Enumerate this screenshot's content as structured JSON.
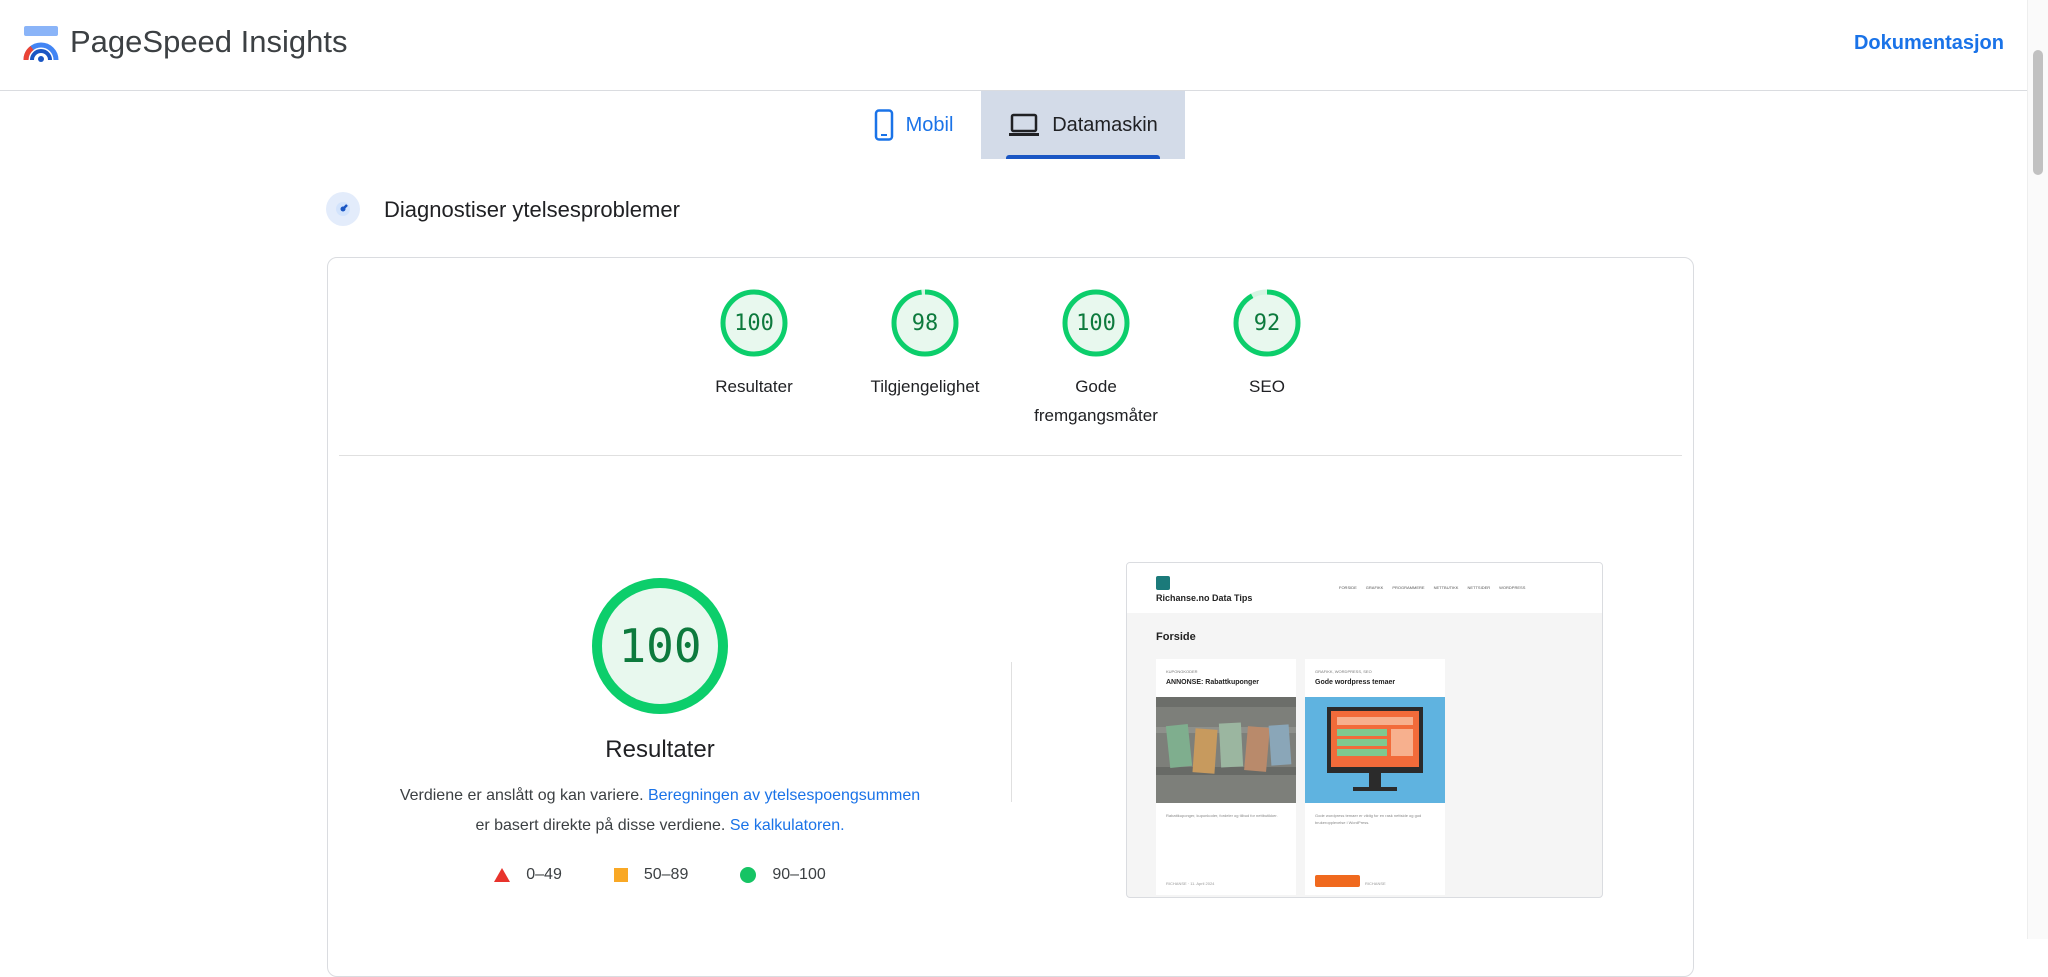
{
  "header": {
    "title": "PageSpeed Insights",
    "doc_link": "Dokumentasjon"
  },
  "tabs": [
    {
      "label": "Mobil",
      "icon": "smartphone-icon",
      "active": false
    },
    {
      "label": "Datamaskin",
      "icon": "laptop-icon",
      "active": true
    }
  ],
  "section": {
    "title": "Diagnostiser ytelsesproblemer"
  },
  "gauges": [
    {
      "score": "100",
      "label": "Resultater"
    },
    {
      "score": "98",
      "label": "Tilgjengelighet"
    },
    {
      "score": "100",
      "label": "Gode fremgangsmåter"
    },
    {
      "score": "92",
      "label": "SEO"
    }
  ],
  "performance": {
    "score": "100",
    "label": "Resultater",
    "desc_part1": "Verdiene er anslått og kan variere. ",
    "desc_link1": "Beregningen av ytelsespoengsummen",
    "desc_part2": "er basert direkte på disse verdiene. ",
    "desc_link2": "Se kalkulatoren."
  },
  "legend": [
    {
      "range": "0–49",
      "color": "#e8332c"
    },
    {
      "range": "50–89",
      "color": "#f9a825"
    },
    {
      "range": "90–100",
      "color": "#16c464"
    }
  ],
  "screenshot": {
    "site_name": "Richanse.no Data Tips",
    "page_title": "Forside",
    "nav": [
      "FORSIDE",
      "GRAFIKK",
      "PROGRAMMERE",
      "NETTBUTIKK",
      "NETTSIDER",
      "WORDPRESS"
    ],
    "posts": [
      {
        "category": "KUPONGKODER",
        "title": "ANNONSE: Rabattkuponger",
        "text": "Rabattkuponger, kuponkoder, fordeler og tilbud for nettbutikker.",
        "meta": "RICHANSE · 11. April 2024"
      },
      {
        "category": "GRAFIKK, WORDPRESS, SEO",
        "title": "Gode wordpress temaer",
        "text": "Gode wordpress temaer er viktig for en rask nettside og god brukeropplevelse i WordPress.",
        "meta": "RICHANSE"
      }
    ]
  },
  "colors": {
    "pass": "#0cce6b",
    "pass_text": "#0d7a3d",
    "accent": "#1a73e8"
  }
}
